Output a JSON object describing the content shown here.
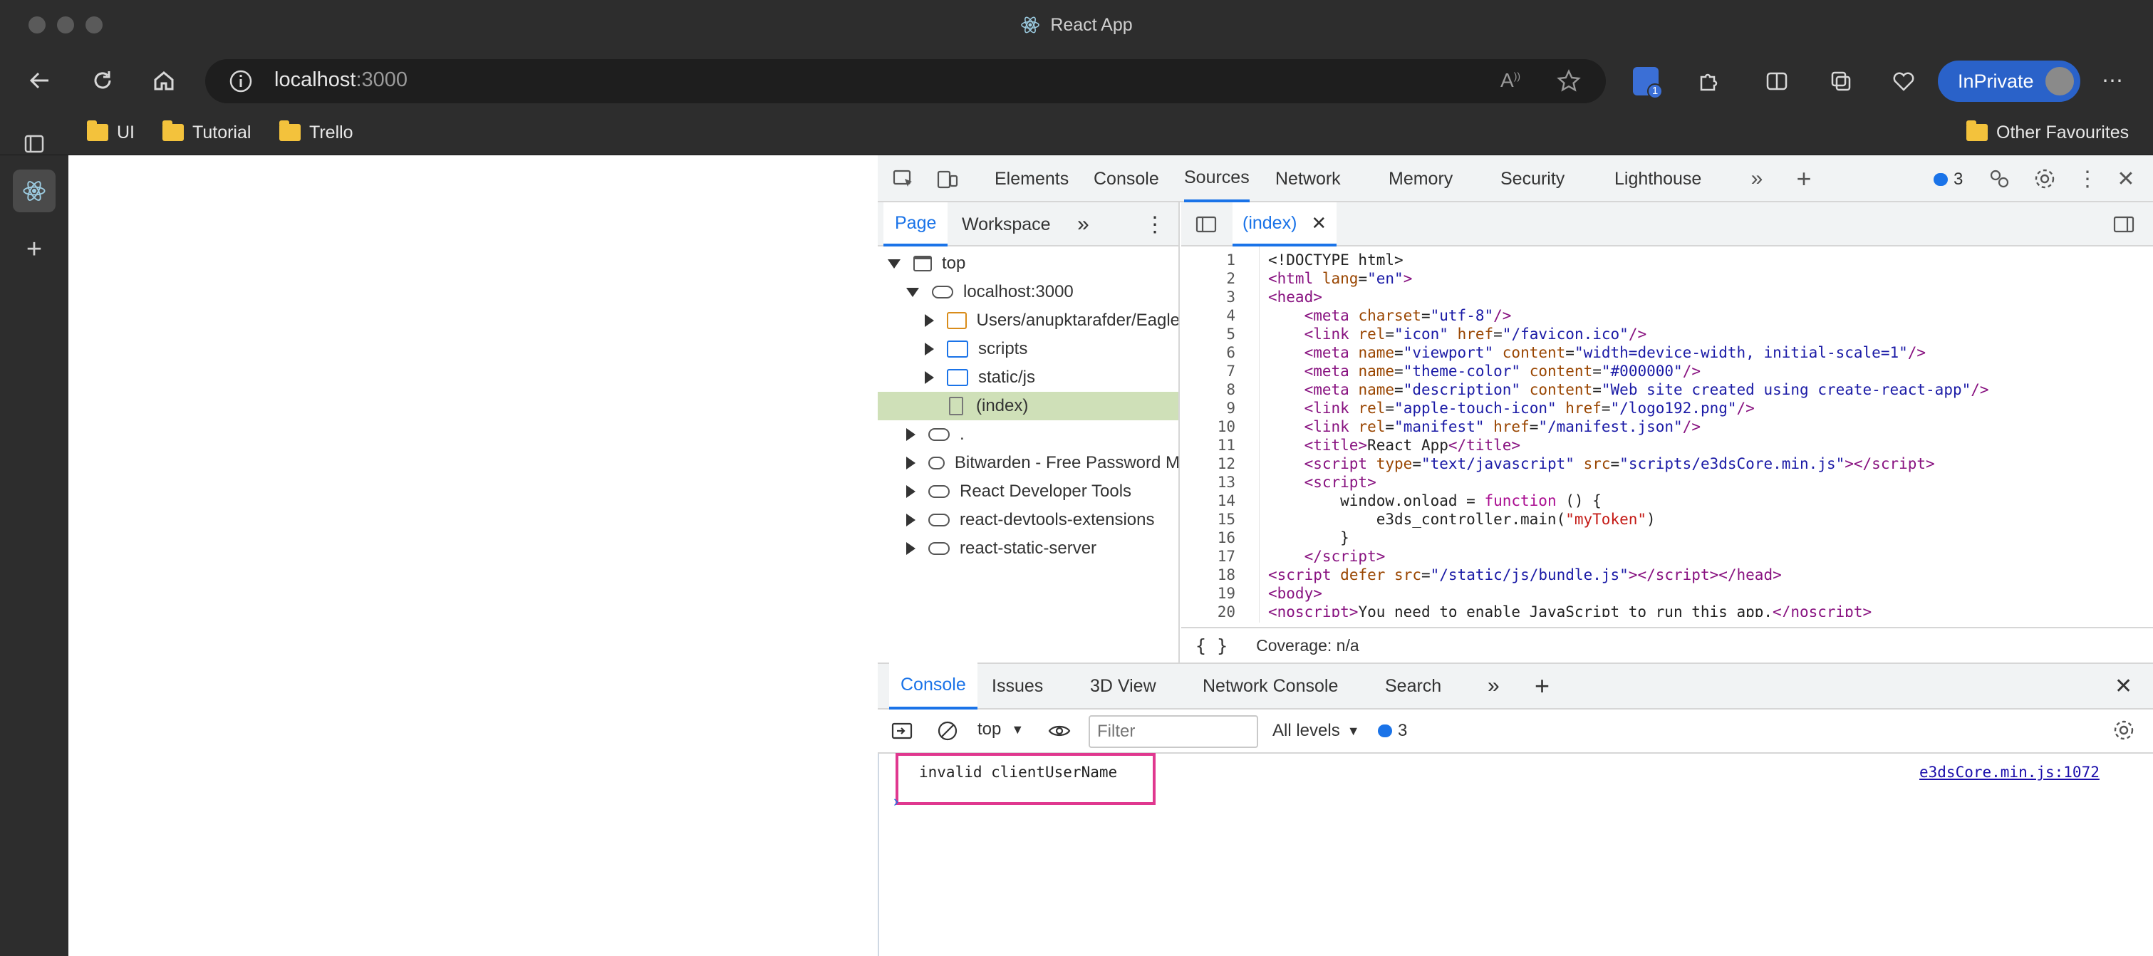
{
  "window": {
    "title": "React App",
    "title_icon": "react-icon"
  },
  "toolbar": {
    "url_host": "localhost",
    "url_port": ":3000",
    "bitwarden_badge": "1",
    "inprivate_label": "InPrivate"
  },
  "favorites": {
    "items": [
      {
        "label": "UI",
        "icon": "folder-icon"
      },
      {
        "label": "Tutorial",
        "icon": "folder-icon"
      },
      {
        "label": "Trello",
        "icon": "folder-icon"
      }
    ],
    "other": "Other Favourites"
  },
  "devtools": {
    "tabs": [
      "Elements",
      "Console",
      "Sources",
      "Network",
      "Memory",
      "Security",
      "Lighthouse"
    ],
    "active_tab": "Sources",
    "issues_count": "3",
    "navigator": {
      "tabs": [
        "Page",
        "Workspace"
      ],
      "tree": [
        {
          "label": "top",
          "level": 0,
          "state": "open",
          "icon": "frame-icon"
        },
        {
          "label": "localhost:3000",
          "level": 1,
          "state": "open",
          "icon": "cloud-icon"
        },
        {
          "label": "Users/anupktarafder/Eagle",
          "level": 2,
          "state": "closed",
          "icon": "folder-icon"
        },
        {
          "label": "scripts",
          "level": 2,
          "state": "closed",
          "icon": "folder-icon"
        },
        {
          "label": "static/js",
          "level": 2,
          "state": "closed",
          "icon": "folder-icon"
        },
        {
          "label": "(index)",
          "level": 3,
          "state": "leaf",
          "icon": "file-icon",
          "selected": true
        },
        {
          "label": ".",
          "level": 1,
          "state": "closed",
          "icon": "cloud-icon"
        },
        {
          "label": "Bitwarden - Free Password M",
          "level": 1,
          "state": "closed",
          "icon": "cloud-icon"
        },
        {
          "label": "React Developer Tools",
          "level": 1,
          "state": "closed",
          "icon": "cloud-icon"
        },
        {
          "label": "react-devtools-extensions",
          "level": 1,
          "state": "closed",
          "icon": "cloud-icon"
        },
        {
          "label": "react-static-server",
          "level": 1,
          "state": "closed",
          "icon": "cloud-icon"
        }
      ]
    },
    "editor": {
      "tab_label": "(index)",
      "coverage": "Coverage: n/a",
      "format_label": "{ }",
      "line_numbers": [
        "1",
        "2",
        "3",
        "4",
        "5",
        "6",
        "7",
        "8",
        "9",
        "10",
        "11",
        "12",
        "13",
        "14",
        "15",
        "16",
        "17",
        "18",
        "19",
        "20"
      ]
    },
    "drawer": {
      "tabs": [
        "Console",
        "Issues",
        "3D View",
        "Network Console",
        "Search"
      ],
      "active_tab": "Console",
      "context": "top",
      "filter_placeholder": "Filter",
      "levels": "All levels",
      "message_count": "3",
      "message": "invalid clientUserName",
      "message_source": "e3dsCore.min.js:1072",
      "prompt": "›"
    }
  }
}
